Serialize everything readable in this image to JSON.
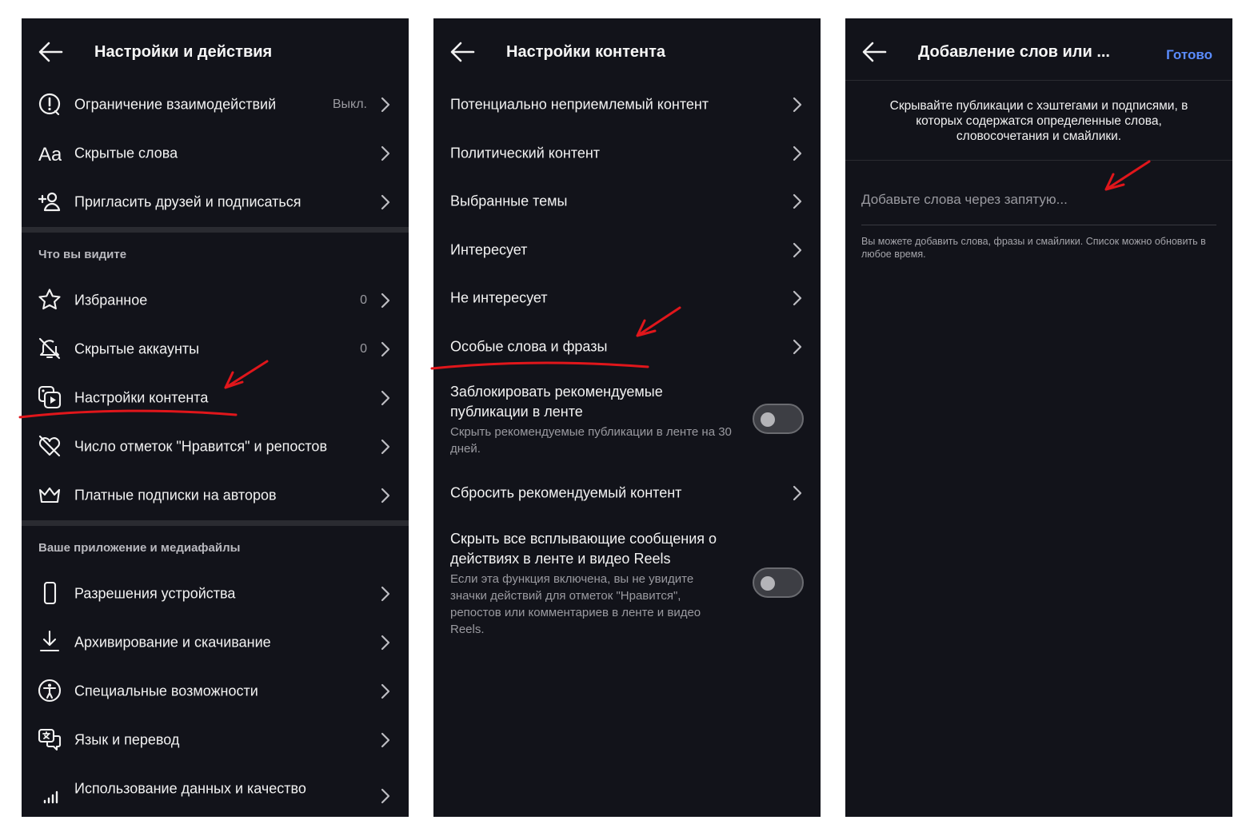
{
  "panel1": {
    "title": "Настройки и действия",
    "top_items": [
      {
        "label": "Ограничение взаимодействий",
        "value": "Выкл.",
        "icon": "alert-circle-icon"
      },
      {
        "label": "Скрытые слова",
        "value": "",
        "icon": "text-aa-icon"
      },
      {
        "label": "Пригласить друзей и подписаться",
        "value": "",
        "icon": "add-user-icon"
      }
    ],
    "section_what_you_see": "Что вы видите",
    "mid_items": [
      {
        "label": "Избранное",
        "value": "0",
        "icon": "star-icon"
      },
      {
        "label": "Скрытые аккаунты",
        "value": "0",
        "icon": "muted-bell-icon"
      },
      {
        "label": "Настройки контента",
        "value": "",
        "icon": "content-media-icon"
      },
      {
        "label": "Число отметок \"Нравится\" и репостов",
        "value": "",
        "icon": "heart-off-icon"
      },
      {
        "label": "Платные подписки на авторов",
        "value": "",
        "icon": "crown-icon"
      }
    ],
    "section_app_media": "Ваше приложение и медиафайлы",
    "bottom_items": [
      {
        "label": "Разрешения устройства",
        "value": "",
        "icon": "phone-icon"
      },
      {
        "label": "Архивирование и скачивание",
        "value": "",
        "icon": "download-icon"
      },
      {
        "label": "Специальные возможности",
        "value": "",
        "icon": "accessibility-icon"
      },
      {
        "label": "Язык и перевод",
        "value": "",
        "icon": "translate-icon"
      },
      {
        "label": "Использование данных и качество",
        "value": "",
        "icon": "signal-bars-icon"
      }
    ]
  },
  "panel2": {
    "title": "Настройки контента",
    "items": [
      "Потенциально неприемлемый контент",
      "Политический контент",
      "Выбранные темы",
      "Интересует",
      "Не интересует",
      "Особые слова и фразы"
    ],
    "toggle1": {
      "title": "Заблокировать рекомендуемые публикации в ленте",
      "desc": "Скрыть рекомендуемые публикации в ленте на 30 дней.",
      "on": false
    },
    "reset_item": "Сбросить рекомендуемый контент",
    "toggle2": {
      "title": "Скрыть все всплывающие сообщения о действиях в ленте и видео Reels",
      "desc": "Если эта функция включена, вы не увидите значки действий для отметок \"Нравится\", репостов или комментариев в ленте и видео Reels.",
      "on": false
    }
  },
  "panel3": {
    "title": "Добавление слов или ...",
    "done_label": "Готово",
    "description": "Скрывайте публикации с хэштегами и подписями, в которых содержатся определенные слова, словосочетания и смайлики.",
    "input_placeholder": "Добавьте слова через запятую...",
    "hint": "Вы можете добавить слова, фразы и смайлики. Список можно обновить в любое время."
  },
  "colors": {
    "background": "#12131a",
    "accent": "#5a8cff",
    "annotation": "#e0161b"
  }
}
